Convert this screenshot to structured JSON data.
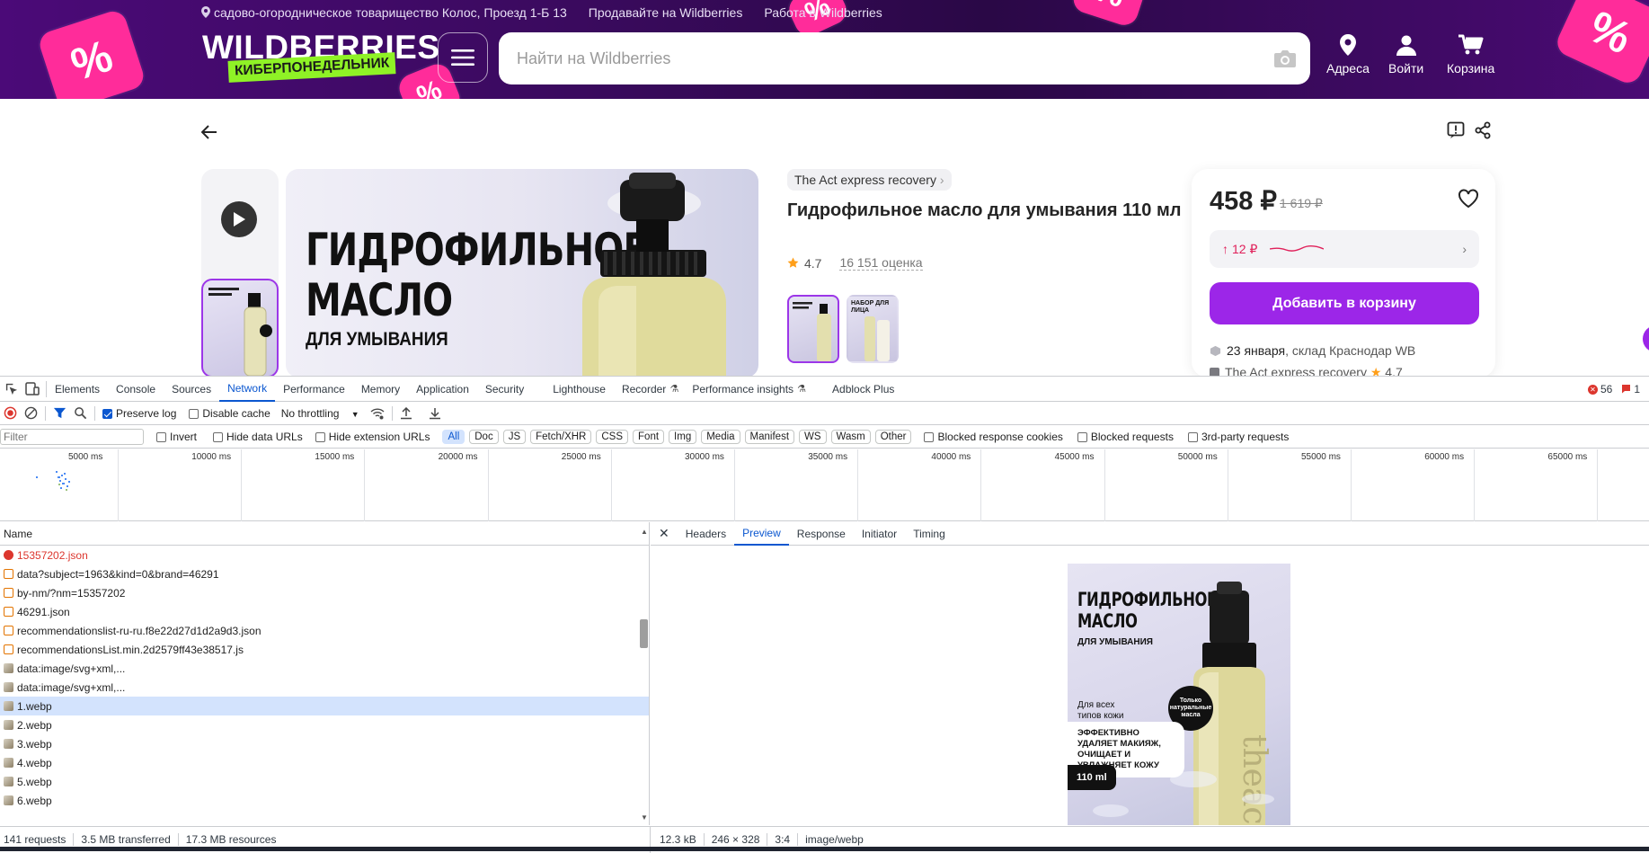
{
  "header": {
    "address": "садово-огородническое товарищество Колос, Проезд 1-Б 13",
    "sell_link": "Продавайте на Wildberries",
    "work_link": "Работа в Wildberries",
    "logo": "WILDBERRIES",
    "logo_sub": "КИБЕРПОНЕДЕЛЬНИК",
    "search_placeholder": "Найти на Wildberries",
    "nav": {
      "addresses": "Адреса",
      "login": "Войти",
      "cart": "Корзина"
    },
    "accent": "#ff2c9a"
  },
  "product": {
    "brand": "The Act express recovery",
    "title": "Гидрофильное масло для умывания 110 мл",
    "rating": "4.7",
    "reviews": "16 151 оценка",
    "image_title": "ГИДРОФИЛЬНОЕ МАСЛО",
    "image_sub": "ДЛЯ УМЫВАНИЯ",
    "variant2_label": "НАБОР ДЛЯ ЛИЦА"
  },
  "price": {
    "current": "458 ₽",
    "old": "1 619 ₽",
    "history": "12 ₽",
    "add_to_cart": "Добавить в корзину",
    "delivery": "23 января",
    "delivery_rest": ", склад Краснодар WB",
    "seller": "The Act express recovery",
    "seller_rating": "4.7",
    "button_color": "#9c26e8"
  },
  "devtools": {
    "tabs": [
      "Elements",
      "Console",
      "Sources",
      "Network",
      "Performance",
      "Memory",
      "Application",
      "Security",
      "Lighthouse",
      "Recorder",
      "Performance insights",
      "Adblock Plus"
    ],
    "active_tab": "Network",
    "errors": "56",
    "warnings": "1",
    "toolbar": {
      "preserve_log": "Preserve log",
      "disable_cache": "Disable cache",
      "throttling": "No throttling"
    },
    "filter": {
      "placeholder": "Filter",
      "invert": "Invert",
      "hide_data": "Hide data URLs",
      "hide_ext": "Hide extension URLs",
      "chips": [
        "All",
        "Doc",
        "JS",
        "Fetch/XHR",
        "CSS",
        "Font",
        "Img",
        "Media",
        "Manifest",
        "WS",
        "Wasm",
        "Other"
      ],
      "blocked_cookies": "Blocked response cookies",
      "blocked_requests": "Blocked requests",
      "third_party": "3rd-party requests"
    },
    "timeline_ticks": [
      "5000 ms",
      "10000 ms",
      "15000 ms",
      "20000 ms",
      "25000 ms",
      "30000 ms",
      "35000 ms",
      "40000 ms",
      "45000 ms",
      "50000 ms",
      "55000 ms",
      "60000 ms",
      "65000 ms"
    ],
    "name_header": "Name",
    "requests": [
      {
        "name": "15357202.json",
        "kind": "error"
      },
      {
        "name": "data?subject=1963&kind=0&brand=46291",
        "kind": "xhr"
      },
      {
        "name": "by-nm/?nm=15357202",
        "kind": "xhr"
      },
      {
        "name": "46291.json",
        "kind": "xhr"
      },
      {
        "name": "recommendationslist-ru-ru.f8e22d27d1d2a9d3.json",
        "kind": "xhr"
      },
      {
        "name": "recommendationsList.min.2d2579ff43e38517.js",
        "kind": "js"
      },
      {
        "name": "data:image/svg+xml,...",
        "kind": "img"
      },
      {
        "name": "data:image/svg+xml,...",
        "kind": "img"
      },
      {
        "name": "1.webp",
        "kind": "img",
        "selected": true
      },
      {
        "name": "2.webp",
        "kind": "img"
      },
      {
        "name": "3.webp",
        "kind": "img"
      },
      {
        "name": "4.webp",
        "kind": "img"
      },
      {
        "name": "5.webp",
        "kind": "img"
      },
      {
        "name": "6.webp",
        "kind": "img"
      }
    ],
    "preview_tabs": [
      "Headers",
      "Preview",
      "Response",
      "Initiator",
      "Timing"
    ],
    "active_preview_tab": "Preview",
    "preview_image": {
      "title": "ГИДРОФИЛЬНОЕ МАСЛО",
      "sub": "ДЛЯ УМЫВАНИЯ",
      "for_all": "Для всех типов кожи",
      "badge": "Только натуральные масла",
      "claim": "ЭФФЕКТИВНО УДАЛЯЕТ МАКИЯЖ, ОЧИЩАЕТ И УВЛАЖНЯЕТ КОЖУ",
      "volume": "110 ml"
    },
    "status": {
      "requests": "141 requests",
      "transferred": "3.5 MB transferred",
      "resources": "17.3 MB resources",
      "size": "12.3 kB",
      "dims": "246 × 328",
      "ratio": "3:4",
      "mime": "image/webp"
    }
  }
}
